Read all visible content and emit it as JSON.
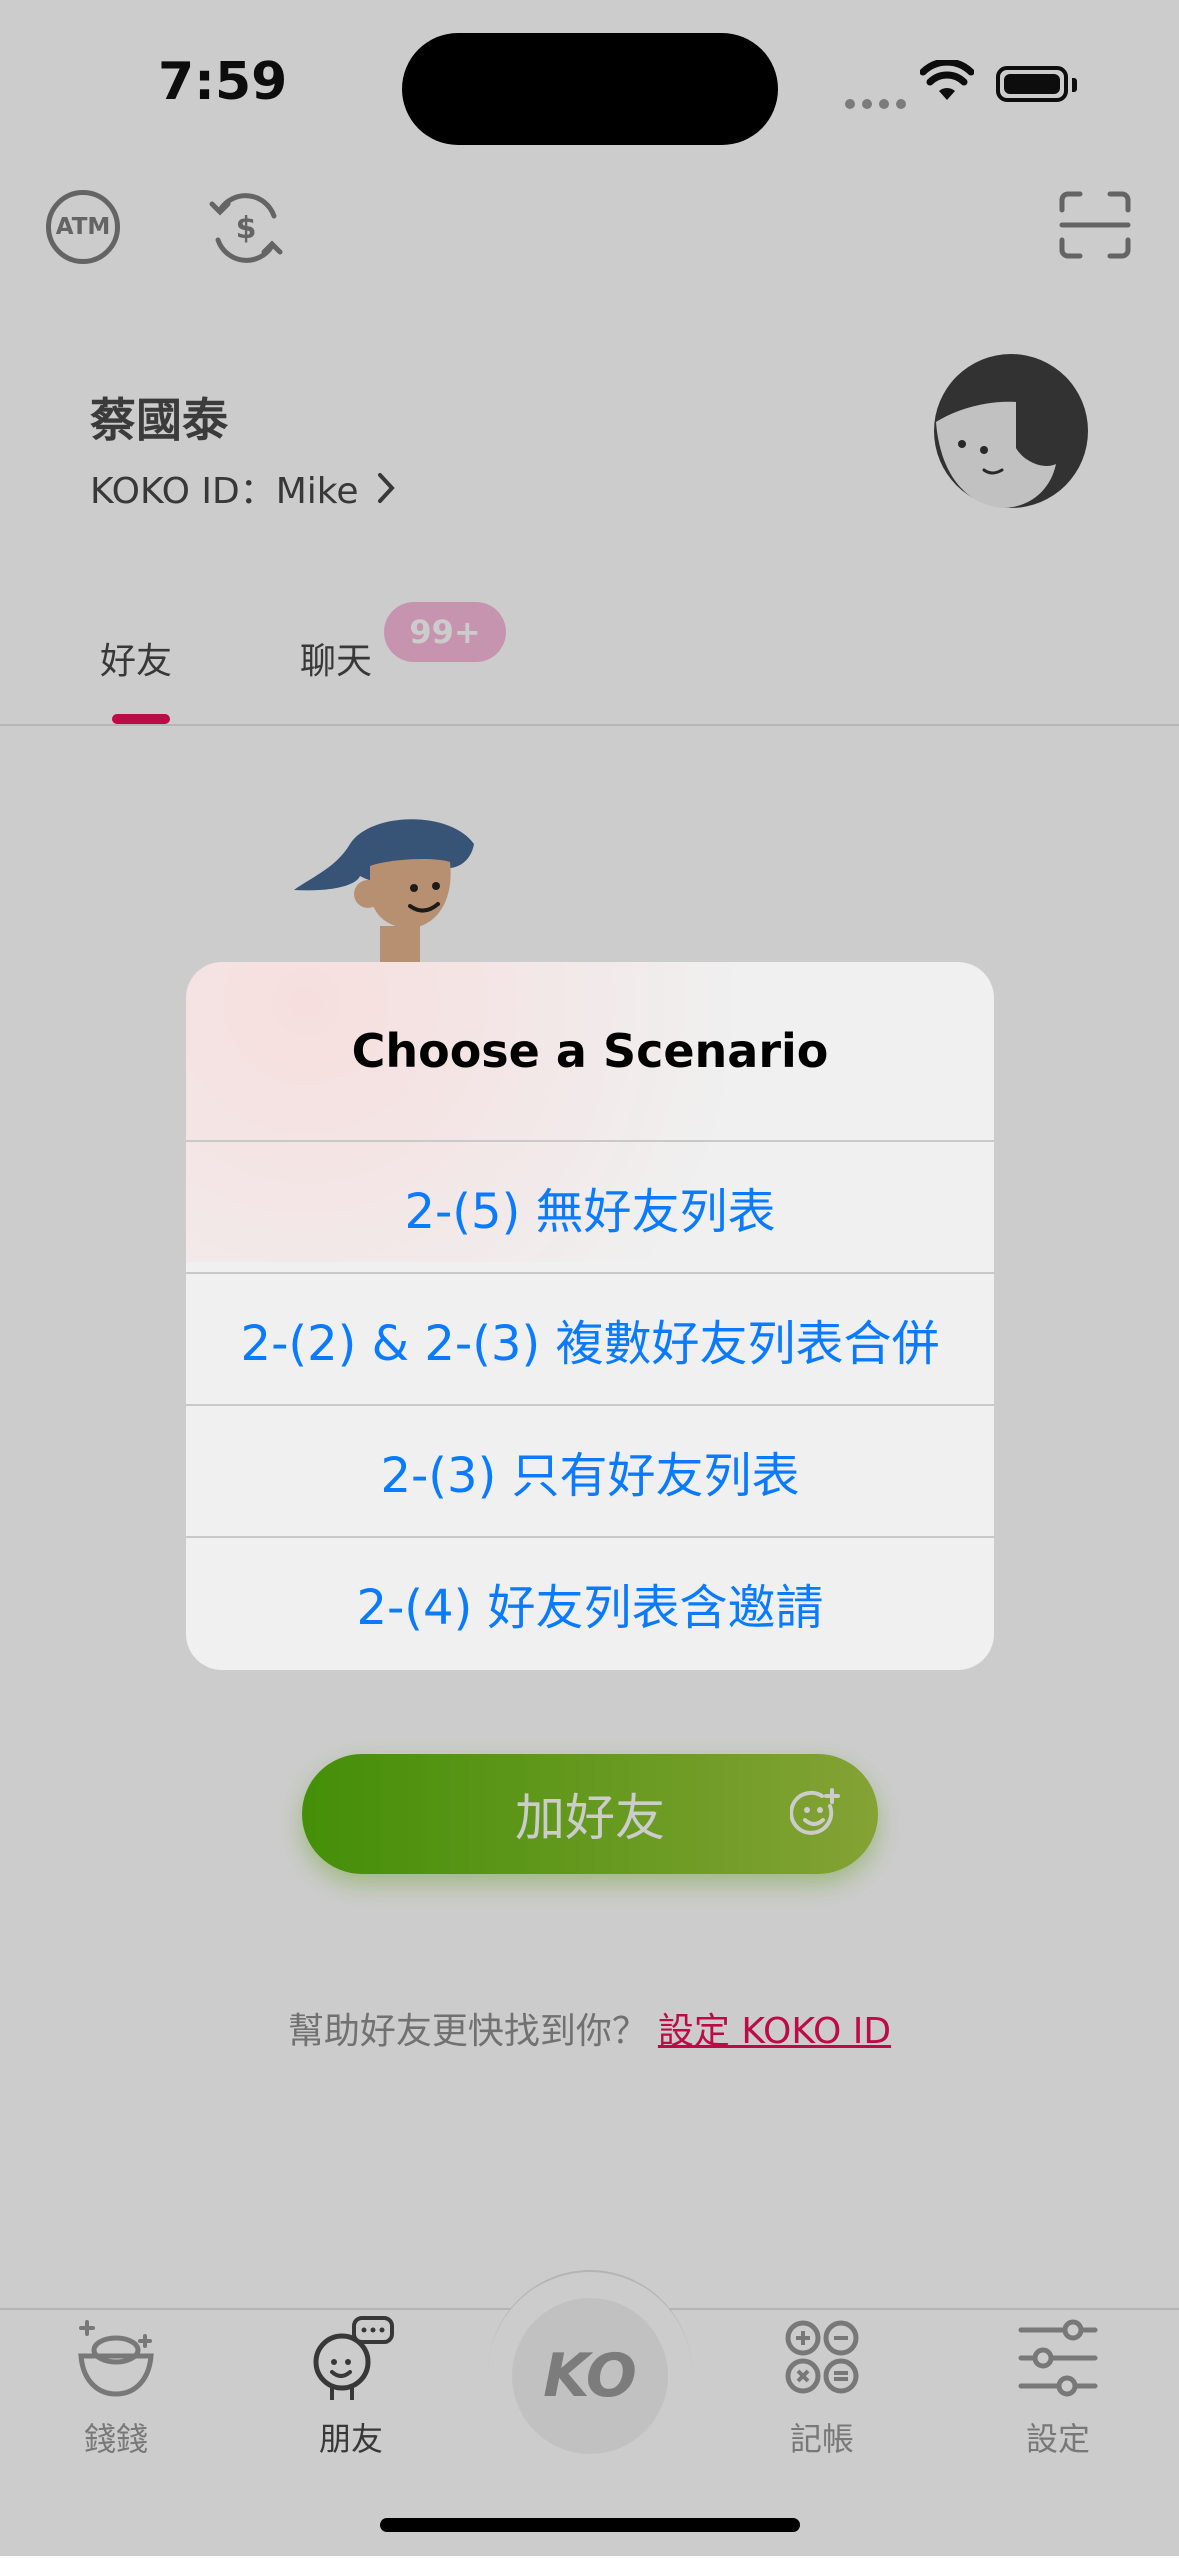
{
  "status_bar": {
    "time": "7:59"
  },
  "header": {
    "atm_label": "ATM"
  },
  "profile": {
    "name": "蔡國泰",
    "koko_id": "KOKO ID：Mike"
  },
  "tabs": {
    "friends": "好友",
    "chat": "聊天",
    "chat_badge": "99+"
  },
  "main": {
    "add_friend_label": "加好友",
    "help_text": "幫助好友更快找到你？",
    "help_link": "設定 KOKO ID"
  },
  "tab_bar": {
    "items": [
      {
        "label": "錢錢",
        "icon": "money-icon"
      },
      {
        "label": "朋友",
        "icon": "friends-icon"
      },
      {
        "label": "KO",
        "icon": "koko-logo-icon"
      },
      {
        "label": "記帳",
        "icon": "ledger-icon"
      },
      {
        "label": "設定",
        "icon": "settings-icon"
      }
    ]
  },
  "alert": {
    "title": "Choose a Scenario",
    "options": [
      "2-(5) 無好友列表",
      "2-(2) & 2-(3) 複數好友列表合併",
      "2-(3) 只有好友列表",
      "2-(4) 好友列表含邀請"
    ]
  },
  "colors": {
    "accent_pink": "#ec0e59",
    "green": "#56b30b",
    "link_blue": "#0a7aff"
  }
}
